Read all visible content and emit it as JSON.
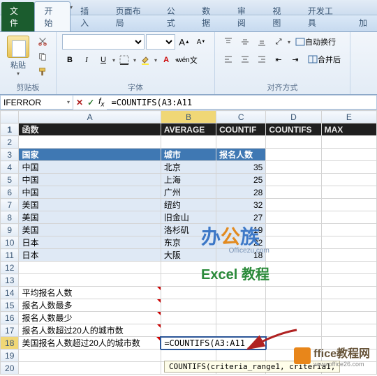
{
  "qat": {
    "excel": "X"
  },
  "tabs": {
    "file": "文件",
    "home": "开始",
    "insert": "插入",
    "layout": "页面布局",
    "formulas": "公式",
    "data": "数据",
    "review": "审阅",
    "view": "视图",
    "developer": "开发工具",
    "addins": "加"
  },
  "ribbon": {
    "clipboard": {
      "paste": "粘贴",
      "label": "剪贴板"
    },
    "font": {
      "label": "字体",
      "grow": "A",
      "shrink": "A",
      "bold": "B",
      "italic": "I",
      "underline": "U"
    },
    "align": {
      "label": "对齐方式",
      "wrap": "自动换行",
      "merge": "合并后"
    }
  },
  "namebox": "IFERROR",
  "formula": "=COUNTIFS(A3:A11",
  "columns": [
    "A",
    "B",
    "C",
    "D",
    "E"
  ],
  "rows": {
    "1": {
      "A": "函数",
      "B": "AVERAGE",
      "C": "COUNTIF",
      "D": "COUNTIFS",
      "E": "MAX"
    },
    "3": {
      "A": "国家",
      "B": "城市",
      "C": "报名人数"
    },
    "4": {
      "A": "中国",
      "B": "北京",
      "C": "35"
    },
    "5": {
      "A": "中国",
      "B": "上海",
      "C": "25"
    },
    "6": {
      "A": "中国",
      "B": "广州",
      "C": "28"
    },
    "7": {
      "A": "美国",
      "B": "纽约",
      "C": "32"
    },
    "8": {
      "A": "美国",
      "B": "旧金山",
      "C": "27"
    },
    "9": {
      "A": "美国",
      "B": "洛杉矶",
      "C": "19"
    },
    "10": {
      "A": "日本",
      "B": "东京",
      "C": "22"
    },
    "11": {
      "A": "日本",
      "B": "大阪",
      "C": "18"
    },
    "14": {
      "A": "平均报名人数"
    },
    "15": {
      "A": "报名人数最多"
    },
    "16": {
      "A": "报名人数最少"
    },
    "17": {
      "A": "报名人数超过20人的城市数"
    },
    "18": {
      "A": "美国报名人数超过20人的城市数",
      "B": "=COUNTIFS(A3:A11"
    }
  },
  "tooltip": "COUNTIFS(criteria_range1, criteria1,",
  "watermark1": {
    "line1a": "办",
    "line1b": "公",
    "line1c": "族",
    "line2": "Officezu.com",
    "line3": "Excel 教程"
  },
  "watermark2": {
    "text": "ffice教程网",
    "sub": "www.office26.com"
  }
}
